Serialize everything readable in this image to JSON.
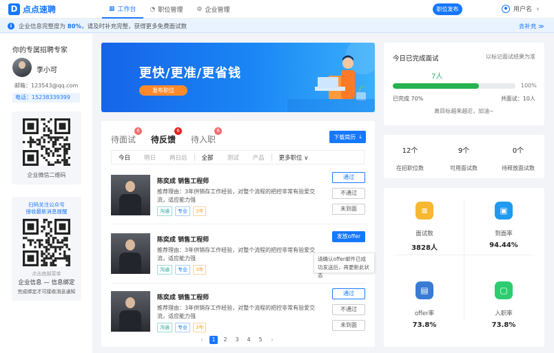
{
  "app": {
    "logo_mark": "D",
    "name": "点点速聘"
  },
  "nav": [
    {
      "label": "工作台",
      "icon": "dashboard-icon",
      "glyph": "▦"
    },
    {
      "label": "职位管理",
      "icon": "briefcase-icon",
      "glyph": "◔"
    },
    {
      "label": "企业管理",
      "icon": "gear-icon",
      "glyph": "⚙"
    }
  ],
  "header": {
    "publish_label": "职位发布",
    "user_label": "用户名",
    "caret": "∨"
  },
  "notice": {
    "icon": "i",
    "text_before": "企业信息完整度为 ",
    "percent": "80%",
    "text_after": "，请及时补充完整，获得更多免费面试数",
    "link": "去补充 ≫"
  },
  "sidebar": {
    "title": "你的专属招聘专家",
    "name": "李小可",
    "email": "邮箱：123543@qq.com",
    "phone": "电话：15238339399",
    "wechat_caption": "企业微信二维码",
    "mp_line1": "扫码关注公众号",
    "mp_line2": "接收最新消息提醒",
    "mp_hint": "点击底部菜单",
    "mp_bold": "企业信息 — 信息绑定",
    "mp_note": "完成绑定才可接收消息通知"
  },
  "banner": {
    "title": "更快/更准/更省钱",
    "button": "发布职位"
  },
  "tabs": [
    {
      "label": "待面试",
      "badge": "6"
    },
    {
      "label": "待反馈",
      "badge": "6"
    },
    {
      "label": "待入职",
      "badge": "6"
    }
  ],
  "download": {
    "label": "下载简历",
    "icon_glyph": "⤓"
  },
  "filters": {
    "days": [
      "今日",
      "明日",
      "两日后"
    ],
    "cats": [
      "全部",
      "测试",
      "产品"
    ],
    "more": "更多职位 ∨"
  },
  "candidates": [
    {
      "name": "陈奕成   销售工程师",
      "desc": "推荐理由：3年供销存工作经验，对整个流程的把控非常有验爱交流，适应能力强",
      "tags": [
        "沟通",
        "专业",
        "3年"
      ],
      "actions": [
        "通过",
        "不通过",
        "未到面"
      ]
    },
    {
      "name": "陈奕成   销售工程师",
      "desc": "推荐理由：3年供销存工作经验，对整个流程的把控非常有验爱交流，适应能力强",
      "tags": [
        "沟通",
        "专业",
        "3年"
      ],
      "actions": [
        "发放offer"
      ],
      "tip": "请确认offer邮件已成功发送后，再更新此状态"
    },
    {
      "name": "陈奕成   销售工程师",
      "desc": "推荐理由：3年供销存工作经验，对整个流程的把控非常有验爱交流，适应能力强",
      "tags": [
        "沟通",
        "专业",
        "3年"
      ],
      "actions": [
        "通过",
        "不通过",
        "未到面"
      ]
    }
  ],
  "pagination": {
    "prev": "‹",
    "pages": [
      "1",
      "2",
      "3",
      "4",
      "5"
    ],
    "next": "›",
    "current": "1"
  },
  "interviews": {
    "title": "今日已完成面试",
    "link": "以标记面试结果为准",
    "count": "7人",
    "progress_percent": 70,
    "progress_label": "100%",
    "done": "已完成 70%",
    "total": "共面试：10人",
    "goal": "离目标越来越近，加油~"
  },
  "stats": [
    {
      "value": "12个",
      "label": "在招职位数"
    },
    {
      "value": "9个",
      "label": "可用面试数"
    },
    {
      "value": "0个",
      "label": "待释放面试数"
    }
  ],
  "kpis": [
    {
      "label": "面试数",
      "value": "3828人",
      "icon": "layers-icon",
      "glyph": "≋",
      "color": "#f7b731"
    },
    {
      "label": "到面率",
      "value": "94.44%",
      "icon": "badge-icon",
      "glyph": "▣",
      "color": "#1e9bf0"
    },
    {
      "label": "offer率",
      "value": "73.8%",
      "icon": "document-icon",
      "glyph": "▤",
      "color": "#3a7bd5"
    },
    {
      "label": "入职率",
      "value": "73.8%",
      "icon": "monitor-icon",
      "glyph": "▢",
      "color": "#2ecc71"
    }
  ],
  "colors": {
    "accent": "#1677ff",
    "orange": "#ff8a2b",
    "green": "#26b24e",
    "badge_red": "#f56c6c"
  }
}
